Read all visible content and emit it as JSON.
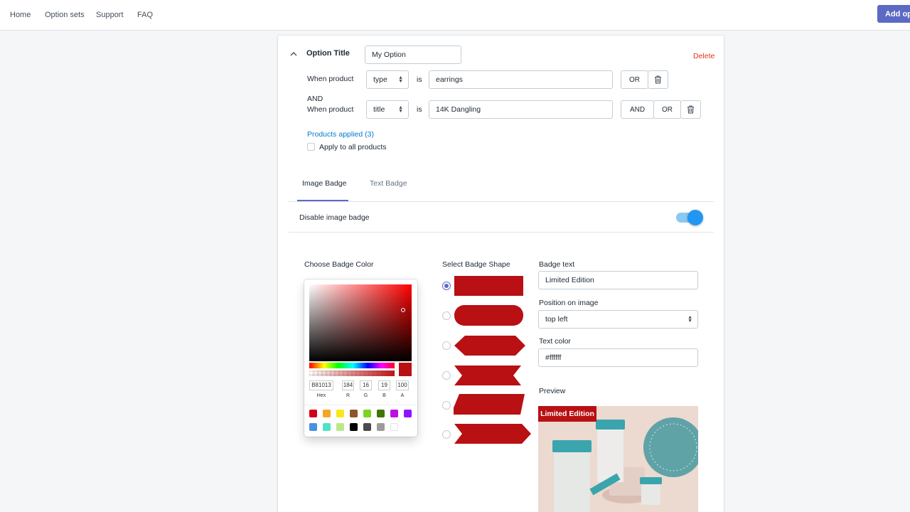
{
  "nav": {
    "home": "Home",
    "option_sets": "Option sets",
    "support": "Support",
    "faq": "FAQ",
    "add_button": "Add opt"
  },
  "option": {
    "title_label": "Option Title",
    "title_value": "My Option",
    "delete": "Delete",
    "condition1": {
      "label": "When product",
      "field": "type",
      "operator": "is",
      "value": "earrings",
      "or": "OR"
    },
    "condition2": {
      "and_prefix": "AND",
      "label": "When product",
      "field": "title",
      "operator": "is",
      "value": "14K Dangling",
      "and": "AND",
      "or": "OR"
    },
    "products_applied": "Products applied (3)",
    "apply_all": "Apply to all products"
  },
  "tabs": [
    {
      "label": "Image Badge",
      "active": true
    },
    {
      "label": "Text Badge",
      "active": false
    }
  ],
  "disable_image_badge": {
    "label": "Disable image badge",
    "enabled": true
  },
  "badge_color": {
    "label": "Choose Badge Color",
    "hex": "B81013",
    "r": "184",
    "g": "16",
    "b": "19",
    "a": "100",
    "hex_label": "Hex",
    "r_label": "R",
    "g_label": "G",
    "b_label": "B",
    "a_label": "A",
    "current": "#b81013",
    "presets": [
      "#d0021b",
      "#f5a623",
      "#f8e71c",
      "#8b572a",
      "#7ed321",
      "#417505",
      "#bd10e0",
      "#9013fe",
      "#4a90e2",
      "#50e3c2",
      "#b8e986",
      "#000000",
      "#4a4a4a",
      "#9b9b9b",
      "#ffffff"
    ]
  },
  "badge_shape": {
    "label": "Select Badge Shape",
    "selected_index": 0,
    "shapes": [
      "rectangle",
      "pill",
      "hexagon",
      "double-notch",
      "parallelogram",
      "arrow"
    ]
  },
  "badge_text": {
    "label": "Badge text",
    "value": "Limited Edition"
  },
  "position": {
    "label": "Position on image",
    "value": "top left"
  },
  "text_color": {
    "label": "Text color",
    "value": "#ffffff"
  },
  "preview": {
    "label": "Preview",
    "badge_text": "Limited Edition"
  },
  "colors": {
    "badge": "#b81013",
    "accent": "#5c6ac4",
    "delete": "#de3618",
    "link": "#007ace"
  }
}
